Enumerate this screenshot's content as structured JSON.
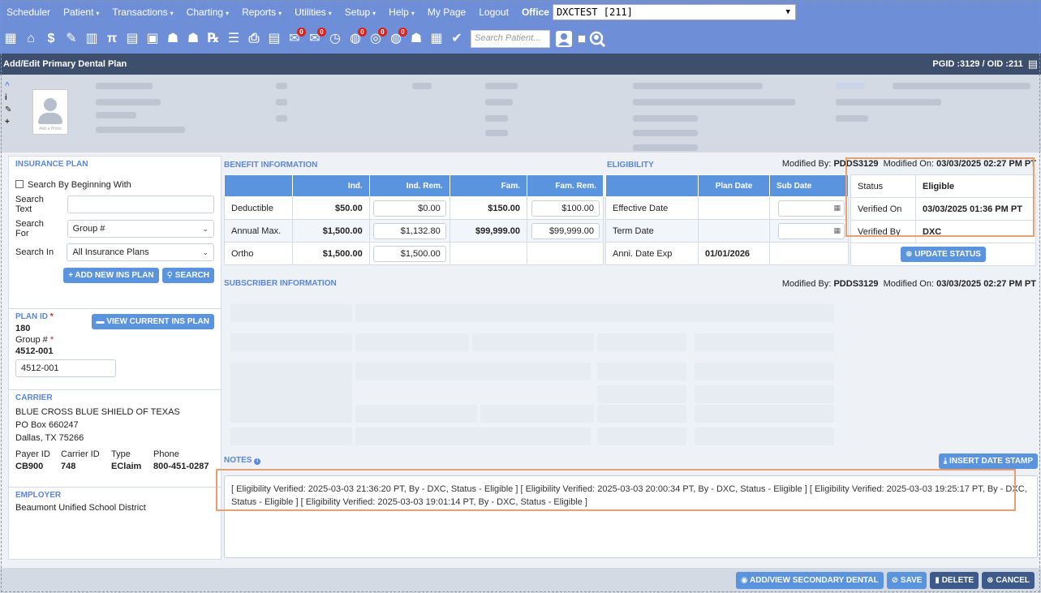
{
  "topnav": {
    "items": [
      {
        "label": "Scheduler",
        "caret": false
      },
      {
        "label": "Patient",
        "caret": true
      },
      {
        "label": "Transactions",
        "caret": true
      },
      {
        "label": "Charting",
        "caret": true
      },
      {
        "label": "Reports",
        "caret": true
      },
      {
        "label": "Utilities",
        "caret": true
      },
      {
        "label": "Setup",
        "caret": true
      },
      {
        "label": "Help",
        "caret": true
      },
      {
        "label": "My Page",
        "caret": false
      },
      {
        "label": "Logout",
        "caret": false
      }
    ],
    "office_label": "Office",
    "office_value": "DXCTEST [211]"
  },
  "toolbar": {
    "search_placeholder": "Search Patient...",
    "icons": [
      {
        "name": "calendar-icon",
        "glyph": "▦",
        "badge": ""
      },
      {
        "name": "home-icon",
        "glyph": "⌂",
        "badge": ""
      },
      {
        "name": "dollar-icon",
        "glyph": "$",
        "badge": ""
      },
      {
        "name": "chart-pen-icon",
        "glyph": "✎",
        "badge": ""
      },
      {
        "name": "tooth-icon",
        "glyph": "▥",
        "badge": ""
      },
      {
        "name": "teeth-icon",
        "glyph": "π",
        "badge": ""
      },
      {
        "name": "pn-icon",
        "glyph": "▤",
        "badge": ""
      },
      {
        "name": "tx-icon",
        "glyph": "▣",
        "badge": ""
      },
      {
        "name": "family-icon",
        "glyph": "☗",
        "badge": ""
      },
      {
        "name": "family-alt-icon",
        "glyph": "☗",
        "badge": ""
      },
      {
        "name": "rx-icon",
        "glyph": "℞",
        "badge": ""
      },
      {
        "name": "list-icon",
        "glyph": "☰",
        "badge": ""
      },
      {
        "name": "printer-icon",
        "glyph": "⎙",
        "badge": ""
      },
      {
        "name": "document-icon",
        "glyph": "▤",
        "badge": ""
      },
      {
        "name": "message-icon",
        "glyph": "✉",
        "badge": "0"
      },
      {
        "name": "sms-icon",
        "glyph": "✉",
        "badge": "0"
      },
      {
        "name": "clock-icon",
        "glyph": "◷",
        "badge": ""
      },
      {
        "name": "globe-chat-icon",
        "glyph": "◍",
        "badge": "0"
      },
      {
        "name": "support-icon",
        "glyph": "◎",
        "badge": "0"
      },
      {
        "name": "web-icon",
        "glyph": "◍",
        "badge": "0"
      },
      {
        "name": "users-icon",
        "glyph": "☗",
        "badge": ""
      },
      {
        "name": "cash-register-icon",
        "glyph": "▦",
        "badge": ""
      },
      {
        "name": "checkmark-box-icon",
        "glyph": "✔",
        "badge": ""
      }
    ]
  },
  "titlebar": {
    "title": "Add/Edit Primary Dental Plan",
    "ids": "PGID :3129 / OID :211"
  },
  "insurance_plan": {
    "title": "INSURANCE PLAN",
    "search_beginning_label": "Search By Beginning With",
    "search_text_label": "Search Text",
    "search_for_label": "Search For",
    "search_for_value": "Group #",
    "search_in_label": "Search In",
    "search_in_value": "All Insurance Plans",
    "add_new_button": "+ ADD NEW INS PLAN",
    "search_button": "SEARCH",
    "plan_id_label": "PLAN ID",
    "plan_id_value": "180",
    "view_current_button": "VIEW CURRENT INS PLAN",
    "group_label": "Group #",
    "group_value": "4512-001",
    "group_input_value": "4512-001",
    "carrier_title": "CARRIER",
    "carrier_name": "BLUE CROSS BLUE SHIELD OF TEXAS",
    "carrier_address1": "PO Box 660247",
    "carrier_address2": "Dallas, TX 75266",
    "payer_id_label": "Payer ID",
    "carrier_id_label": "Carrier ID",
    "type_label": "Type",
    "phone_label": "Phone",
    "payer_id": "CB900",
    "carrier_id": "748",
    "type": "EClaim",
    "phone": "800-451-0287",
    "employer_title": "EMPLOYER",
    "employer_name": "Beaumont Unified School District"
  },
  "benefit": {
    "title": "BENEFIT INFORMATION",
    "headers": [
      "",
      "Ind.",
      "Ind. Rem.",
      "Fam.",
      "Fam. Rem."
    ],
    "rows": [
      {
        "label": "Deductible",
        "ind": "$50.00",
        "ind_rem": "$0.00",
        "fam": "$150.00",
        "fam_rem": "$100.00"
      },
      {
        "label": "Annual Max.",
        "ind": "$1,500.00",
        "ind_rem": "$1,132.80",
        "fam": "$99,999.00",
        "fam_rem": "$99,999.00"
      },
      {
        "label": "Ortho",
        "ind": "$1,500.00",
        "ind_rem": "$1,500.00"
      }
    ]
  },
  "eligibility": {
    "title": "ELIGIBILITY",
    "modified_by_label": "Modified By:",
    "modified_by": "PDDS3129",
    "modified_on_label": "Modified On:",
    "modified_on": "03/03/2025 02:27 PM PT",
    "headers": [
      "",
      "Plan Date",
      "Sub Date"
    ],
    "rows": [
      {
        "label": "Effective Date",
        "plan_date": ""
      },
      {
        "label": "Term Date",
        "plan_date": ""
      },
      {
        "label": "Anni. Date Exp",
        "plan_date": "01/01/2026"
      }
    ],
    "status_rows": [
      {
        "label": "Status",
        "value": "Eligible"
      },
      {
        "label": "Verified On",
        "value": "03/03/2025 01:36 PM PT"
      },
      {
        "label": "Verified By",
        "value": "DXC"
      }
    ],
    "update_button": "UPDATE STATUS"
  },
  "subscriber": {
    "title": "SUBSCRIBER INFORMATION",
    "modified_by_label": "Modified By:",
    "modified_by": "PDDS3129",
    "modified_on_label": "Modified On:",
    "modified_on": "03/03/2025 02:27 PM PT"
  },
  "notes": {
    "title": "NOTES",
    "insert_button": "INSERT DATE STAMP",
    "text": "[ Eligibility Verified: 2025-03-03 21:36:20 PT, By - DXC, Status - Eligible ] [ Eligibility Verified: 2025-03-03 20:00:34 PT, By - DXC, Status - Eligible ] [ Eligibility Verified: 2025-03-03 19:25:17 PT, By - DXC, Status - Eligible ] [ Eligibility Verified: 2025-03-03 19:01:14 PT, By - DXC, Status - Eligible ]"
  },
  "bottom": {
    "add_secondary": "ADD/VIEW SECONDARY DENTAL",
    "save": "SAVE",
    "delete": "DELETE",
    "cancel": "CANCEL"
  },
  "colors": {
    "nav": "#6e8fd8",
    "titlebar": "#3e4f6e",
    "accent": "#5a93de",
    "highlight": "#e8a070"
  }
}
